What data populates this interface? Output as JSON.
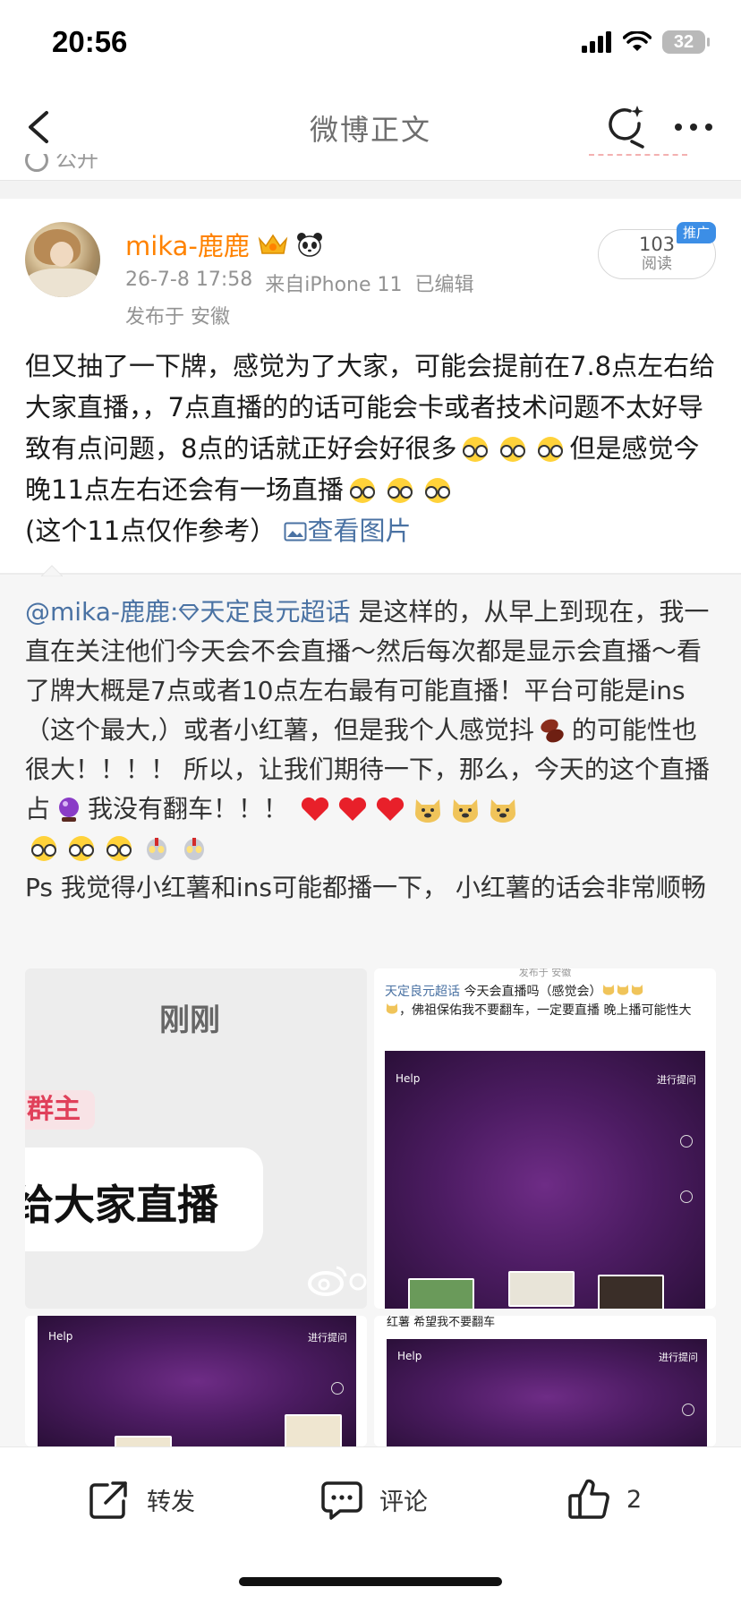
{
  "status_bar": {
    "time": "20:56",
    "battery": "32"
  },
  "nav": {
    "title": "微博正文"
  },
  "top_sliver": {
    "visibility": "公开"
  },
  "post": {
    "username": "mika-鹿鹿",
    "meta": {
      "date": "26-7-8 17:58",
      "source": "来自iPhone 11",
      "edited": "已编辑"
    },
    "location": "发布于 安徽",
    "read_count": "103",
    "read_label": "阅读",
    "promo_tag": "推广",
    "text_p1": "但又抽了一下牌，感觉为了大家，可能会提前在7.8点左右给大家直播，，7点直播的的话可能会卡或者技术问题不太好导致有点问题，8点的话就正好会好很多",
    "text_p2": "但是感觉今晚11点左右还会有一场直播",
    "text_p3": "(这个11点仅作参考）",
    "view_image_link": "查看图片"
  },
  "repost": {
    "author_link": "@mika-鹿鹿:",
    "topic_link": "天定良元超话",
    "text_p1": " 是这样的，从早上到现在，我一直在关注他们今天会不会直播～然后每次都是显示会直播～看了牌大概是7点或者10点左右最有可能直播！平台可能是ins（这个最大,）或者小红薯，但是我个人感觉抖",
    "text_p2": "的可能性也很大！！！！ 所以，让我们期待一下，那么，今天的这个直播占",
    "text_p3": "我没有翻车！！！",
    "text_ps": "Ps 我觉得小红薯和ins可能都播一下， 小红薯的话会非常顺畅"
  },
  "images": {
    "a": {
      "just_now": "刚刚",
      "owner_tag": "群主",
      "bubble": "给大家直播"
    },
    "b": {
      "header": "发布于 安徽",
      "topic": "天定良元超话",
      "caption_1": " 今天会直播吗（感觉会）",
      "caption_2": "，佛祖保佑我不要翻车，一定要直播",
      "caption_3": "晚上播可能性大",
      "help": "Help",
      "ask": "进行提问"
    },
    "c": {
      "help": "Help",
      "ask": "进行提问"
    },
    "d": {
      "caption": "红薯 希望我不要翻车",
      "help": "Help",
      "ask": "进行提问"
    }
  },
  "toolbar": {
    "share": "转发",
    "comment": "评论",
    "like_count": "2"
  },
  "colors": {
    "username": "#ff8200",
    "link": "#4a72a3",
    "promo": "#3c8ee6",
    "heart": "#e8202a"
  }
}
